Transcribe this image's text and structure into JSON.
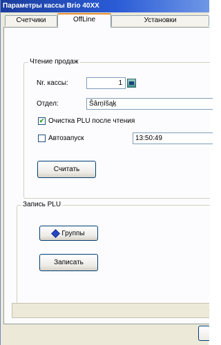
{
  "window": {
    "title": "Параметры кассы Brio 40XX"
  },
  "tabs": [
    {
      "label": "Счетчики"
    },
    {
      "label": "OffLine"
    },
    {
      "label": "Установки"
    }
  ],
  "read_sales": {
    "title": "Чтение продаж",
    "register_label": "Nr. кассы:",
    "register_value": "1",
    "department_label": "Отдел:",
    "department_value": "Šârņīšąķ",
    "clear_plu_label": "Очистка PLU после чтения",
    "clear_plu_checked": "✔",
    "autostart_label": "Автозапуск",
    "autostart_time": "13:50:49",
    "read_button": "Считать"
  },
  "write_plu": {
    "title": "Запись PLU",
    "groups_button": "Группы",
    "write_button": "Записать"
  }
}
